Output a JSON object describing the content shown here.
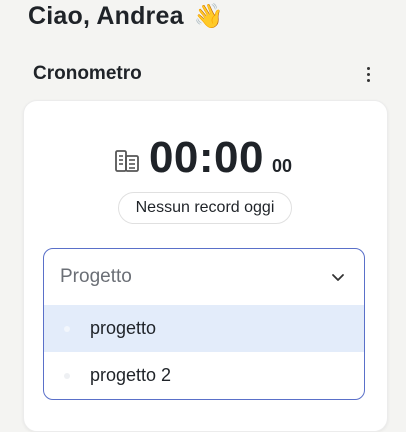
{
  "greeting": {
    "text": "Ciao, Andrea",
    "emoji": "👋"
  },
  "section": {
    "title": "Cronometro",
    "menu_icon": "kebab-menu-icon"
  },
  "timer": {
    "icon": "building-icon",
    "main": "00:00",
    "seconds": "00",
    "record_text": "Nessun record oggi"
  },
  "project_select": {
    "placeholder": "Progetto",
    "options": [
      {
        "label": "progetto",
        "highlighted": true
      },
      {
        "label": "progetto 2",
        "highlighted": false
      }
    ]
  },
  "colors": {
    "accent_border": "#5a70c9",
    "highlight_bg": "#e3ecfa",
    "page_bg": "#f4f4f2"
  }
}
